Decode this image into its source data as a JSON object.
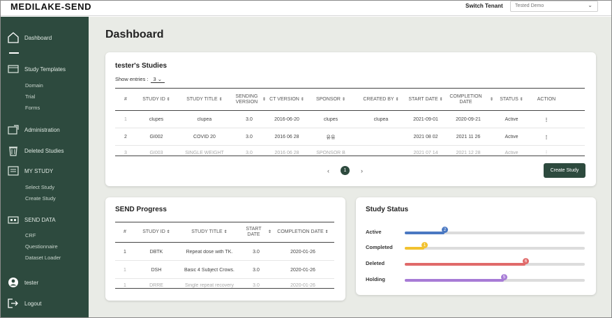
{
  "app": {
    "brand": "MEDILAKE-SEND"
  },
  "topbar": {
    "switch_label": "Switch Tenant",
    "tenant_value": "Tested Demo"
  },
  "sidebar": {
    "dashboard": "Dashboard",
    "study_templates": "Study Templates",
    "sub_templates": [
      "Domain",
      "Trial",
      "Forms"
    ],
    "administration": "Administration",
    "deleted_studies": "Deleted Studies",
    "my_study": "MY STUDY",
    "sub_my_study": [
      "Select Study",
      "Create Study"
    ],
    "send_data": "SEND DATA",
    "sub_send_data": [
      "CRF",
      "Questionnaire",
      "Dataset Loader"
    ],
    "user": "tester",
    "logout": "Logout"
  },
  "main": {
    "page_title": "Dashboard"
  },
  "studies": {
    "title": "tester's Studies",
    "show_entries_label": "Show entries :",
    "show_entries_value": "3",
    "columns": [
      "#",
      "STUDY ID",
      "STUDY TITLE",
      "SENDING VERSION",
      "CT VERSION",
      "SPONSOR",
      "CREATED BY",
      "START DATE",
      "COMPLETION DATE",
      "STATUS",
      "ACTION"
    ],
    "rows": [
      [
        "1",
        "clupes",
        "clupea",
        "3.0",
        "2016-06-20",
        "clupes",
        "clupea",
        "2021-09-01",
        "2020-09-21",
        "Active",
        "⋮"
      ],
      [
        "2",
        "GI002",
        "COVID 20",
        "3.0",
        "2016 06 28",
        "유유",
        "",
        "2021 08 02",
        "2021 11 26",
        "Active",
        "⋮"
      ],
      [
        "3",
        "GI003",
        "SINGLE WEIGHT",
        "3.0",
        "2016 06 28",
        "SPONSOR B",
        "",
        "2021 07 14",
        "2021 12 28",
        "Active",
        "⋮"
      ]
    ],
    "pager": {
      "prev": "‹",
      "page": "1",
      "next": "›"
    },
    "create_label": "Create Study"
  },
  "progress": {
    "title": "SEND Progress",
    "columns": [
      "#",
      "STUDY ID",
      "STUDY TITLE",
      "START DATE",
      "COMPLETION DATE"
    ],
    "rows": [
      [
        "1",
        "DBTK",
        "Repeat dose with TK.",
        "3.0",
        "2020-01-26"
      ],
      [
        "1",
        "DSH",
        "Basic 4 Subject Crows.",
        "3.0",
        "2020-01-26"
      ],
      [
        "1",
        "DRRE",
        "Single repeat recovery",
        "3.0",
        "2020-01-26"
      ]
    ]
  },
  "study_status": {
    "title": "Study Status",
    "items": [
      {
        "label": "Active",
        "count": "2",
        "fraction": 0.22,
        "color": "#4a78c2"
      },
      {
        "label": "Completed",
        "count": "1",
        "fraction": 0.11,
        "color": "#f2c230"
      },
      {
        "label": "Deleted",
        "count": "6",
        "fraction": 0.67,
        "color": "#e06a6a"
      },
      {
        "label": "Holding",
        "count": "5",
        "fraction": 0.55,
        "color": "#a77bd6"
      }
    ]
  }
}
